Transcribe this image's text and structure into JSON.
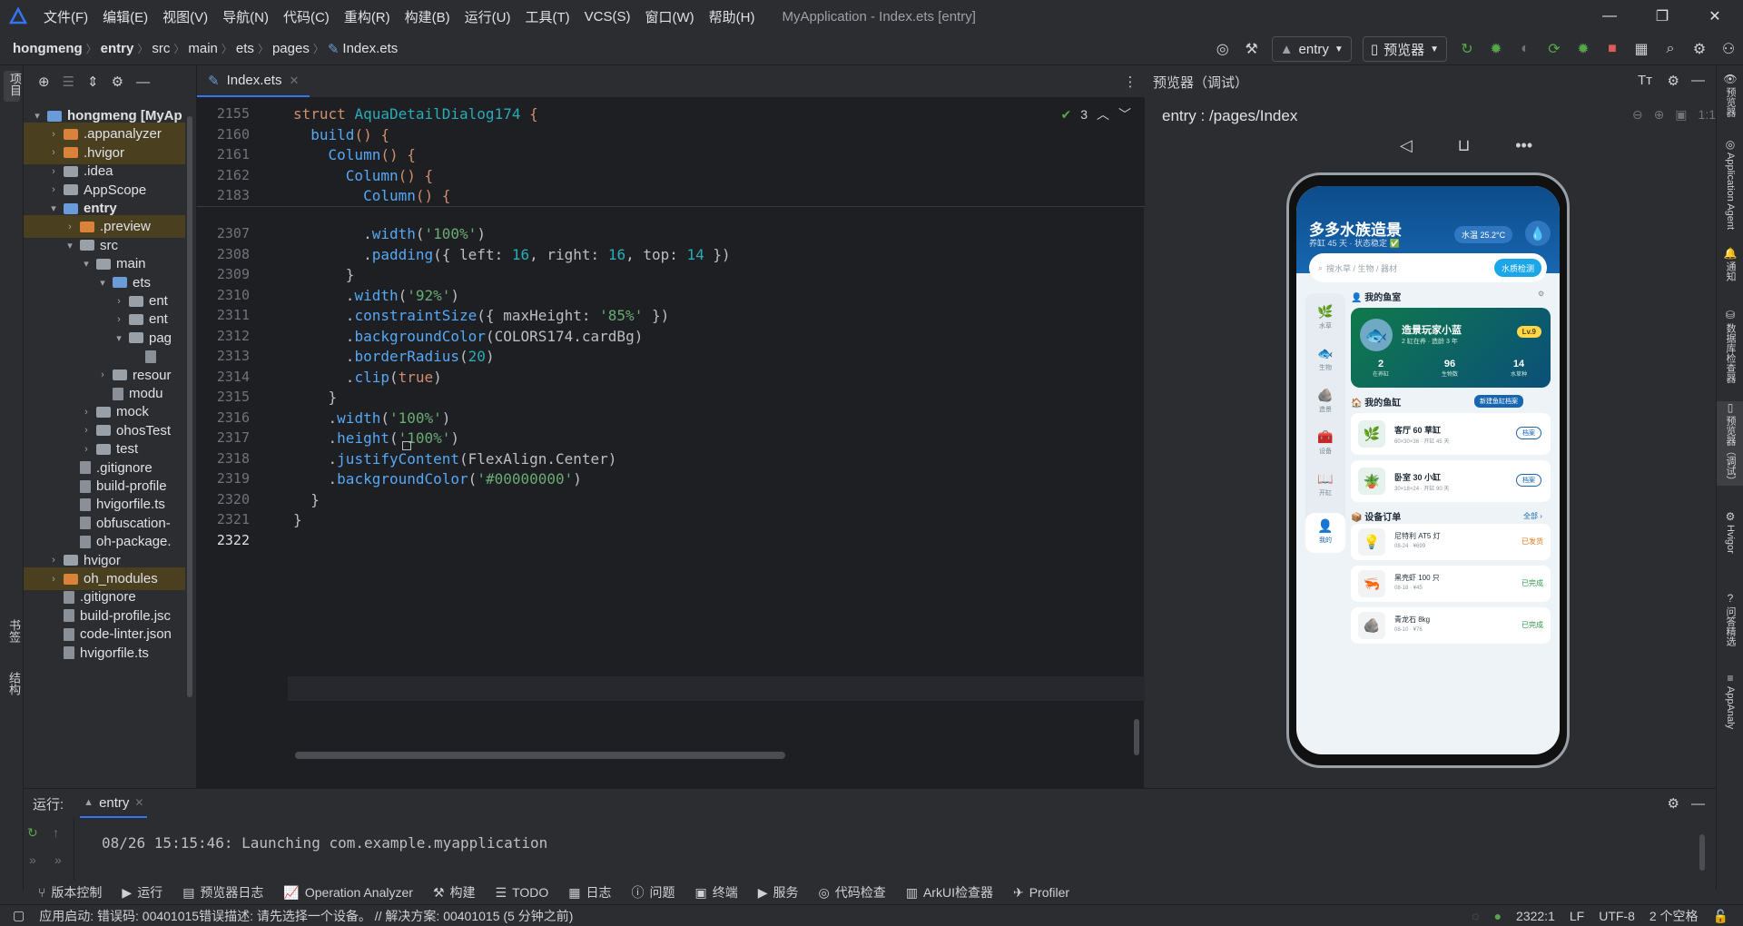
{
  "title_bar": {
    "menus": [
      "文件(F)",
      "编辑(E)",
      "视图(V)",
      "导航(N)",
      "代码(C)",
      "重构(R)",
      "构建(B)",
      "运行(U)",
      "工具(T)",
      "VCS(S)",
      "窗口(W)",
      "帮助(H)"
    ],
    "window_title": "MyApplication - Index.ets [entry]"
  },
  "breadcrumb": [
    "hongmeng",
    "entry",
    "src",
    "main",
    "ets",
    "pages",
    "Index.ets"
  ],
  "toolbar": {
    "run_config": "entry",
    "device": "预览器"
  },
  "left_strip": {
    "project_label": "项目",
    "bookmarks_label": "书签",
    "structure_label": "结构"
  },
  "project_tree": [
    {
      "label": "hongmeng [MyAp",
      "depth": 0,
      "expanded": true,
      "kind": "folder-blue",
      "bold": true
    },
    {
      "label": ".appanalyzer",
      "depth": 1,
      "expanded": false,
      "kind": "folder-orange",
      "highlight": true
    },
    {
      "label": ".hvigor",
      "depth": 1,
      "expanded": false,
      "kind": "folder-orange",
      "highlight": true
    },
    {
      "label": ".idea",
      "depth": 1,
      "expanded": false,
      "kind": "folder-gray"
    },
    {
      "label": "AppScope",
      "depth": 1,
      "expanded": false,
      "kind": "folder-gray"
    },
    {
      "label": "entry",
      "depth": 1,
      "expanded": true,
      "kind": "folder-blue",
      "bold": true
    },
    {
      "label": ".preview",
      "depth": 2,
      "expanded": false,
      "kind": "folder-orange",
      "highlight": true
    },
    {
      "label": "src",
      "depth": 2,
      "expanded": true,
      "kind": "folder-gray"
    },
    {
      "label": "main",
      "depth": 3,
      "expanded": true,
      "kind": "folder-gray"
    },
    {
      "label": "ets",
      "depth": 4,
      "expanded": true,
      "kind": "folder-blue"
    },
    {
      "label": "ent",
      "depth": 5,
      "expanded": false,
      "kind": "folder-gray"
    },
    {
      "label": "ent",
      "depth": 5,
      "expanded": false,
      "kind": "folder-gray"
    },
    {
      "label": "pag",
      "depth": 5,
      "expanded": true,
      "kind": "folder-gray"
    },
    {
      "label": "",
      "depth": 6,
      "expanded": null,
      "kind": "file"
    },
    {
      "label": "resour",
      "depth": 4,
      "expanded": false,
      "kind": "folder-gray"
    },
    {
      "label": "modu",
      "depth": 4,
      "expanded": null,
      "kind": "file"
    },
    {
      "label": "mock",
      "depth": 3,
      "expanded": false,
      "kind": "folder-gray"
    },
    {
      "label": "ohosTest",
      "depth": 3,
      "expanded": false,
      "kind": "folder-gray"
    },
    {
      "label": "test",
      "depth": 3,
      "expanded": false,
      "kind": "folder-gray"
    },
    {
      "label": ".gitignore",
      "depth": 2,
      "expanded": null,
      "kind": "file"
    },
    {
      "label": "build-profile",
      "depth": 2,
      "expanded": null,
      "kind": "file"
    },
    {
      "label": "hvigorfile.ts",
      "depth": 2,
      "expanded": null,
      "kind": "file"
    },
    {
      "label": "obfuscation-",
      "depth": 2,
      "expanded": null,
      "kind": "file"
    },
    {
      "label": "oh-package.",
      "depth": 2,
      "expanded": null,
      "kind": "file"
    },
    {
      "label": "hvigor",
      "depth": 1,
      "expanded": false,
      "kind": "folder-gray"
    },
    {
      "label": "oh_modules",
      "depth": 1,
      "expanded": false,
      "kind": "folder-orange",
      "highlight": true
    },
    {
      "label": ".gitignore",
      "depth": 1,
      "expanded": null,
      "kind": "file"
    },
    {
      "label": "build-profile.jsc",
      "depth": 1,
      "expanded": null,
      "kind": "file"
    },
    {
      "label": "code-linter.json",
      "depth": 1,
      "expanded": null,
      "kind": "file"
    },
    {
      "label": "hvigorfile.ts",
      "depth": 1,
      "expanded": null,
      "kind": "file"
    }
  ],
  "editor": {
    "tab_label": "Index.ets",
    "inspection_count": "3",
    "sticky_lines": [
      {
        "num": "2155",
        "html": "<span class='kw'>struct</span> <span class='cls'>AquaDetailDialog174</span> <span class='kw'>{</span>"
      },
      {
        "num": "2160",
        "html": "  <span class='fn'>build</span><span class='kw'>()</span> <span class='kw'>{</span>"
      },
      {
        "num": "2161",
        "html": "    <span class='fn'>Column</span><span class='kw'>()</span> <span class='kw'>{</span>"
      },
      {
        "num": "2162",
        "html": "      <span class='fn'>Column</span><span class='kw'>()</span> <span class='kw'>{</span>"
      },
      {
        "num": "2183",
        "html": "        <span class='fn'>Column</span><span class='kw'>()</span> <span class='kw'>{</span>"
      }
    ],
    "lines": [
      {
        "num": "2307",
        "html": "        .<span class='fn'>width</span>(<span class='str'>'100%'</span>)"
      },
      {
        "num": "2308",
        "html": "        .<span class='fn'>padding</span>({ left: <span class='num'>16</span>, right: <span class='num'>16</span>, top: <span class='num'>14</span> })"
      },
      {
        "num": "2309",
        "html": "      }"
      },
      {
        "num": "2310",
        "html": "      .<span class='fn'>width</span>(<span class='str'>'92%'</span>)"
      },
      {
        "num": "2311",
        "html": "      .<span class='fn'>constraintSize</span>({ maxHeight: <span class='str'>'85%'</span> })"
      },
      {
        "num": "2312",
        "html": "      .<span class='fn'>backgroundColor</span>(COLORS174.cardBg)"
      },
      {
        "num": "2313",
        "html": "      .<span class='fn'>borderRadius</span>(<span class='num'>20</span>)"
      },
      {
        "num": "2314",
        "html": "      .<span class='fn'>clip</span>(<span class='kw'>true</span>)"
      },
      {
        "num": "2315",
        "html": "    }"
      },
      {
        "num": "2316",
        "html": "    .<span class='fn'>width</span>(<span class='str'>'100%'</span>)"
      },
      {
        "num": "2317",
        "html": "    .<span class='fn'>height</span>(<span class='str'>'100%'</span>)"
      },
      {
        "num": "2318",
        "html": "    .<span class='fn'>justifyContent</span>(FlexAlign.Center)"
      },
      {
        "num": "2319",
        "html": "    .<span class='fn'>backgroundColor</span>(<span class='str'>'#00000000'</span>)"
      },
      {
        "num": "2320",
        "html": "  }"
      },
      {
        "num": "2321",
        "html": "}"
      },
      {
        "num": "2322",
        "html": ""
      }
    ]
  },
  "preview": {
    "panel_title": "预览器（调试）",
    "path": "entry : /pages/Index",
    "app": {
      "title": "多多水族造景",
      "subtitle": "养缸 45 天 · 状态稳定 ✅",
      "temp_chip": "水温 25.2°C",
      "search_placeholder": "搜水草 / 生物 / 器材",
      "search_button": "水质检测",
      "nav": [
        "水草",
        "生物",
        "造景",
        "设备",
        "开缸",
        "我的"
      ],
      "my_room_title": "我的鱼室",
      "hero_name": "造景玩家小蓝",
      "hero_sub": "2 缸在养 · 造龄 3 年",
      "hero_level": "Lv.9",
      "hero_stats": [
        {
          "value": "2",
          "label": "在养缸"
        },
        {
          "value": "96",
          "label": "生物数"
        },
        {
          "value": "14",
          "label": "水草种"
        }
      ],
      "my_tanks_title": "我的鱼缸",
      "tank_button": "新建鱼缸档案",
      "tanks": [
        {
          "name": "客厅 60 草缸",
          "sub": "60×30×36 · 开缸 45 天",
          "action": "档案"
        },
        {
          "name": "卧室 30 小缸",
          "sub": "30×18×24 · 开缸 90 天",
          "action": "档案"
        }
      ],
      "orders_title": "设备订单",
      "orders_more": "全部 ›",
      "orders": [
        {
          "name": "尼特利 AT5 灯",
          "sub": "08-24 · ¥699",
          "status": "已发货",
          "color": "#e07b1c"
        },
        {
          "name": "黑壳虾 100 只",
          "sub": "08-18 · ¥45",
          "status": "已完成",
          "color": "#2e9a4a"
        },
        {
          "name": "青龙石 8kg",
          "sub": "08-10 · ¥76",
          "status": "已完成",
          "color": "#2e9a4a"
        }
      ]
    }
  },
  "right_strip": [
    "预览器",
    "Application Agent",
    "通知",
    "数据库检查器",
    "预览器（调试）",
    "Hvigor",
    "问答精选",
    "AppAnaly"
  ],
  "run_panel": {
    "label": "运行:",
    "tab": "entry",
    "output": "08/26 15:15:46: Launching com.example.myapplication"
  },
  "tool_windows": [
    "版本控制",
    "运行",
    "预览器日志",
    "Operation Analyzer",
    "构建",
    "TODO",
    "日志",
    "问题",
    "终端",
    "服务",
    "代码检查",
    "ArkUI检查器",
    "Profiler"
  ],
  "status_bar": {
    "message": "应用启动: 错误码: 00401015错误描述: 请先选择一个设备。 // 解决方案: 00401015 (5 分钟之前)",
    "position": "2322:1",
    "line_sep": "LF",
    "encoding": "UTF-8",
    "indent": "2 个空格"
  }
}
